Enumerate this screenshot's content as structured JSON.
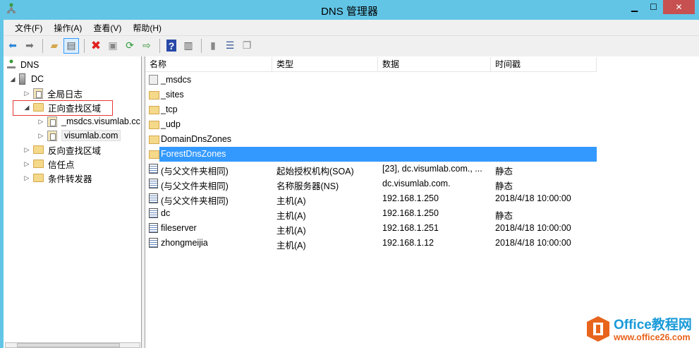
{
  "window": {
    "title": "DNS 管理器",
    "minimize": "▁",
    "maximize": "☐",
    "close": "✕"
  },
  "menu": [
    "文件(F)",
    "操作(A)",
    "查看(V)",
    "帮助(H)"
  ],
  "toolbar": [
    "back-icon",
    "forward-icon",
    "up-folder-icon",
    "show-hide-tree-icon",
    "delete-icon",
    "properties-icon",
    "refresh-icon",
    "export-icon",
    "help-icon",
    "action-pane-icon",
    "server-icon",
    "record-icon",
    "copy-icon"
  ],
  "tree": {
    "root": "DNS",
    "server": "DC",
    "items": [
      "全局日志",
      "正向查找区域",
      "_msdcs.visumlab.cc",
      "visumlab.com",
      "反向查找区域",
      "信任点",
      "条件转发器"
    ]
  },
  "columns": [
    "名称",
    "类型",
    "数据",
    "时间戳"
  ],
  "rows": [
    {
      "name": "_msdcs",
      "type": "",
      "data": "",
      "ts": "",
      "icon": "zone"
    },
    {
      "name": "_sites",
      "type": "",
      "data": "",
      "ts": "",
      "icon": "folder"
    },
    {
      "name": "_tcp",
      "type": "",
      "data": "",
      "ts": "",
      "icon": "folder"
    },
    {
      "name": "_udp",
      "type": "",
      "data": "",
      "ts": "",
      "icon": "folder"
    },
    {
      "name": "DomainDnsZones",
      "type": "",
      "data": "",
      "ts": "",
      "icon": "folder"
    },
    {
      "name": "ForestDnsZones",
      "type": "",
      "data": "",
      "ts": "",
      "icon": "folder"
    },
    {
      "name": "(与父文件夹相同)",
      "type": "起始授权机构(SOA)",
      "data": "[23], dc.visumlab.com., ...",
      "ts": "静态",
      "icon": "record"
    },
    {
      "name": "(与父文件夹相同)",
      "type": "名称服务器(NS)",
      "data": "dc.visumlab.com.",
      "ts": "静态",
      "icon": "record"
    },
    {
      "name": "(与父文件夹相同)",
      "type": "主机(A)",
      "data": "192.168.1.250",
      "ts": "2018/4/18 10:00:00",
      "icon": "record"
    },
    {
      "name": "dc",
      "type": "主机(A)",
      "data": "192.168.1.250",
      "ts": "静态",
      "icon": "record"
    },
    {
      "name": "fileserver",
      "type": "主机(A)",
      "data": "192.168.1.251",
      "ts": "2018/4/18 10:00:00",
      "icon": "record"
    },
    {
      "name": "zhongmeijia",
      "type": "主机(A)",
      "data": "192.168.1.12",
      "ts": "2018/4/18 10:00:00",
      "icon": "record"
    }
  ],
  "watermark": {
    "brand": "Office教程网",
    "url": "www.office26.com"
  }
}
